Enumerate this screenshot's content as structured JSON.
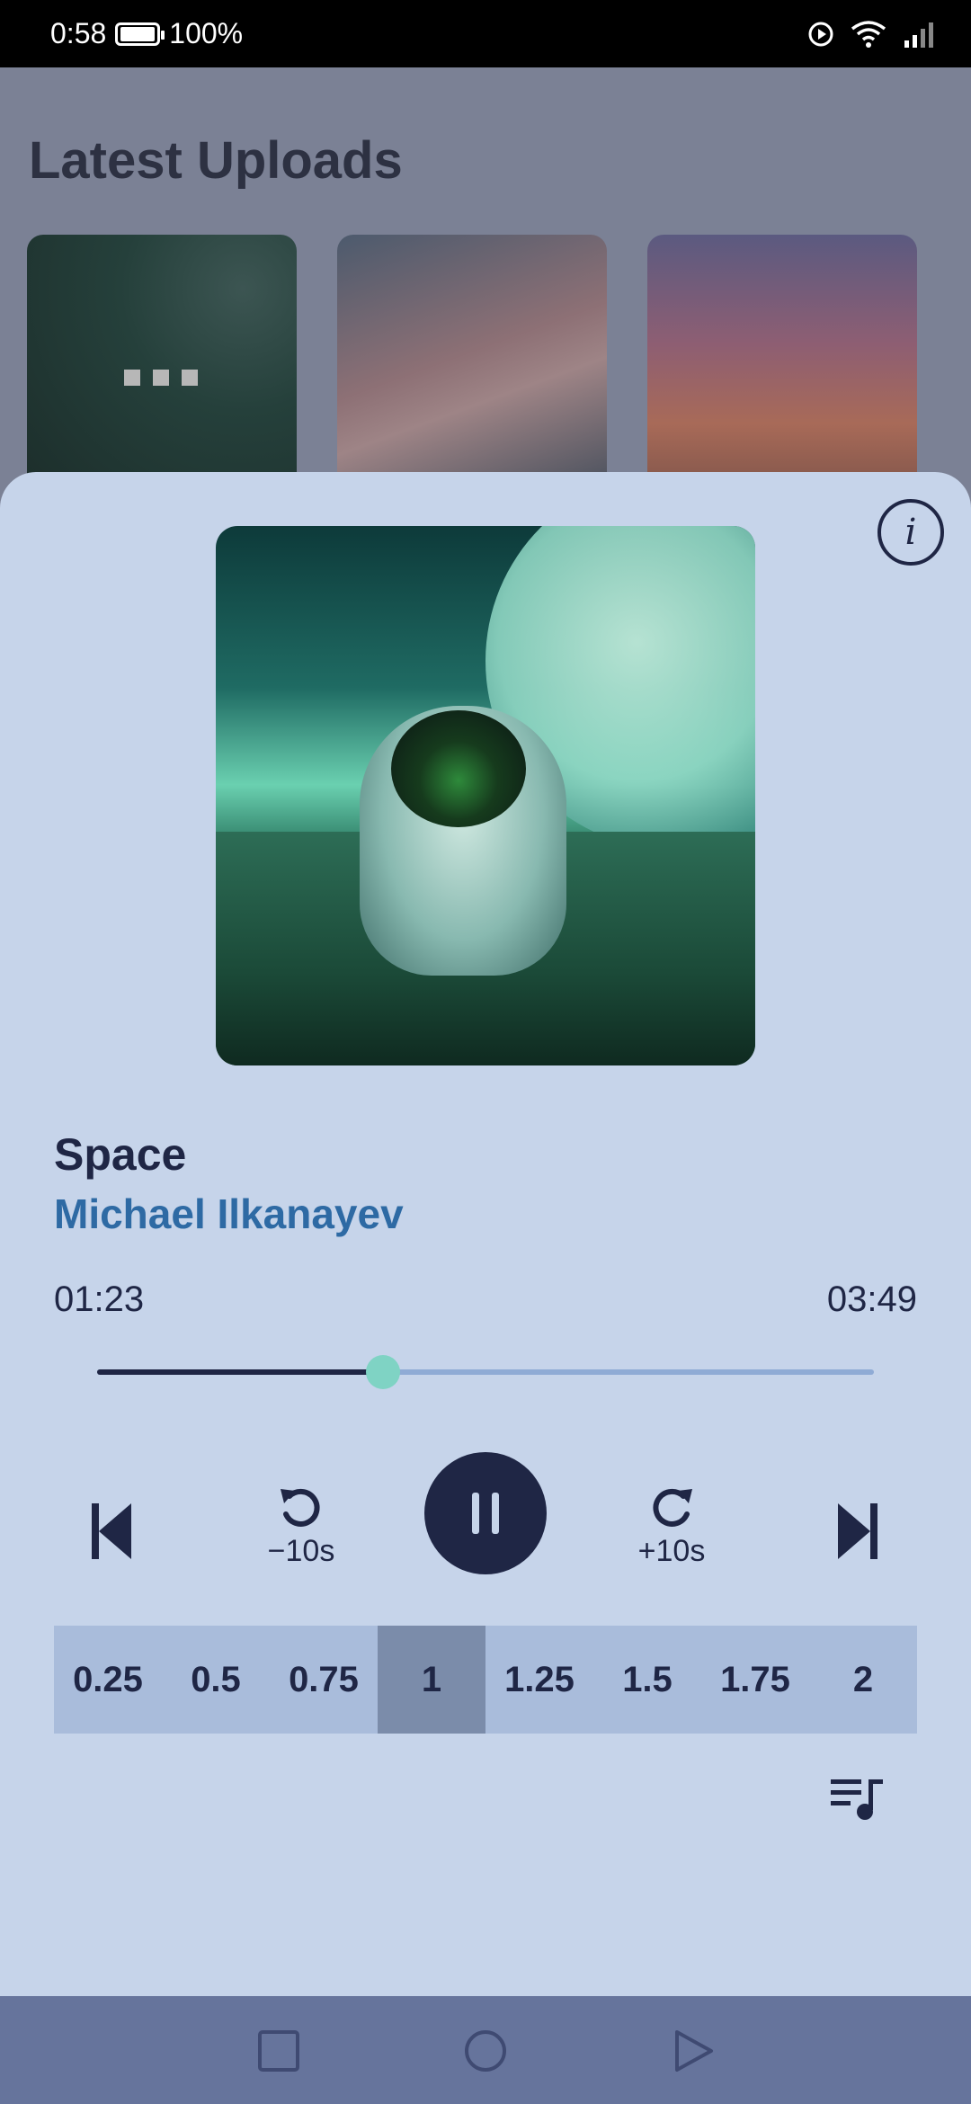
{
  "status_bar": {
    "time": "0:58",
    "battery": "100%"
  },
  "background": {
    "section_title": "Latest Uploads"
  },
  "player": {
    "title": "Space",
    "artist": "Michael Ilkanayev",
    "current_time": "01:23",
    "total_time": "03:49",
    "progress_fraction": 0.368,
    "rewind_label": "−10s",
    "forward_label": "+10s",
    "speed_options": [
      "0.25",
      "0.5",
      "0.75",
      "1",
      "1.25",
      "1.5",
      "1.75",
      "2"
    ],
    "selected_speed": "1"
  },
  "colors": {
    "accent": "#1f2645",
    "artist": "#2e6aa4",
    "seek_thumb": "#7fd3c4",
    "sheet": "#c6d4ea"
  }
}
